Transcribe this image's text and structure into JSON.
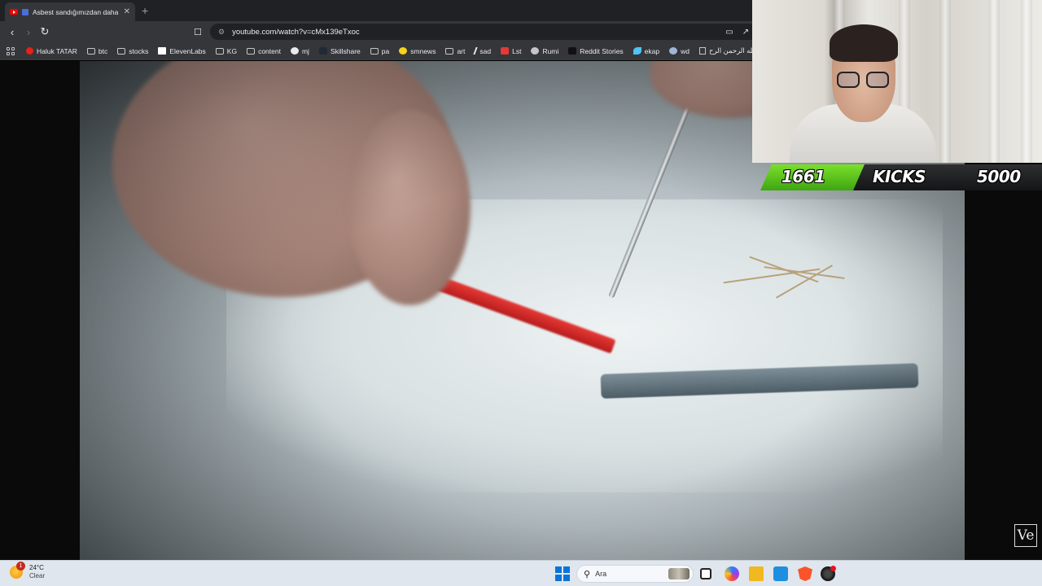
{
  "browser": {
    "tab_title": "Asbest sandığımızdan daha b",
    "new_tab_symbol": "+",
    "url": "youtube.com/watch?v=cMx139eTxoc",
    "bookmarks": [
      {
        "label": "Haluk TATAR",
        "icon": "youtube-icon"
      },
      {
        "label": "btc",
        "icon": "folder-icon"
      },
      {
        "label": "stocks",
        "icon": "folder-icon"
      },
      {
        "label": "ElevenLabs",
        "icon": "elevenlabs-icon"
      },
      {
        "label": "KG",
        "icon": "folder-icon"
      },
      {
        "label": "content",
        "icon": "folder-icon"
      },
      {
        "label": "mj",
        "icon": "github-icon"
      },
      {
        "label": "Skillshare",
        "icon": "skillshare-icon"
      },
      {
        "label": "pa",
        "icon": "folder-icon"
      },
      {
        "label": "smnews",
        "icon": "smiley-icon"
      },
      {
        "label": "art",
        "icon": "folder-icon"
      },
      {
        "label": "sad",
        "icon": "slash-icon"
      },
      {
        "label": "Lst",
        "icon": "s-logo-icon"
      },
      {
        "label": "Rumi",
        "icon": "globe-icon"
      },
      {
        "label": "Reddit Stories",
        "icon": "d-logo-icon"
      },
      {
        "label": "ekap",
        "icon": "bird-icon"
      },
      {
        "label": "wd",
        "icon": "globe-icon"
      },
      {
        "label": "الله الرحمن الرح...",
        "icon": "page-icon"
      }
    ]
  },
  "overlay": {
    "kicks_current": "1661",
    "kicks_label": "KICKS",
    "kicks_goal": "5000"
  },
  "video": {
    "watermark": "Ve"
  },
  "taskbar": {
    "weather_badge": "1",
    "temperature": "24°C",
    "condition": "Clear",
    "search_placeholder": "Ara"
  },
  "colors": {
    "kicks_green": "#5cc61e",
    "taskbar_bg": "#dfe6ee",
    "browser_dark": "#35363a"
  }
}
